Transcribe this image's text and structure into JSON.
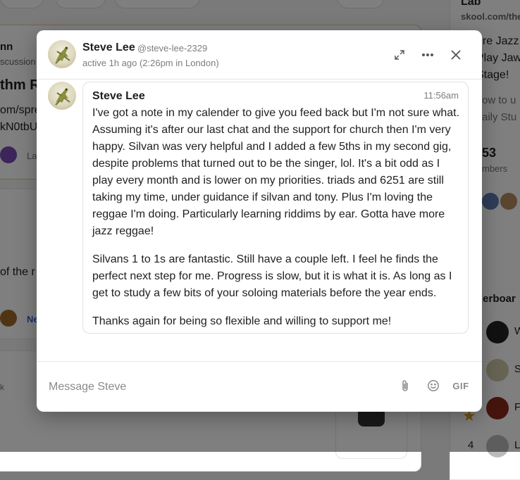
{
  "background": {
    "left_snippets": [
      "nn",
      "scussion",
      "thm R",
      "om/spre",
      "kN0tbU",
      "La",
      "of the r",
      "Ne",
      "k"
    ],
    "right_snippets": [
      "Lab",
      "skool.com/the",
      "ere Jazz",
      "Play Jaw",
      "Stage!",
      "ow to u",
      "aily Stu",
      "53",
      "mbers",
      "derboar",
      "W",
      "S",
      "F",
      "L",
      "4"
    ]
  },
  "modal": {
    "header": {
      "name": "Steve Lee",
      "handle": "@steve-lee-2329",
      "status": "active 1h ago (2:26pm in London)",
      "icons": {
        "expand": "expand-icon",
        "more": "more-options-icon",
        "close": "close-icon"
      }
    },
    "message": {
      "sender": "Steve Lee",
      "time": "11:56am",
      "paragraphs": [
        "I've got a note in my calender to give you feed back but I'm not sure what. Assuming it's after our last chat and the support for church then I'm very happy. Silvan was very helpful and I added a few 5ths in my second gig, despite problems that turned out to be the singer, lol. It's a bit odd as I play every month and is lower on my priorities. triads and 6251 are still taking my time, under guidance if silvan and tony. Plus I'm loving the reggae I'm doing. Particularly learning riddims by ear. Gotta have more jazz reggae!",
        "Silvans 1 to 1s are fantastic. Still have a couple left. I feel he finds the perfect next step for me. Progress is slow, but it is what it is. As long as I get to study a few bits of your soloing materials before the year ends.",
        "Thanks again for being so flexible and willing to support me!"
      ]
    },
    "composer": {
      "placeholder": "Message Steve",
      "value": "",
      "gif_label": "GIF",
      "icons": {
        "attach": "paperclip-icon",
        "emoji": "emoji-icon"
      }
    }
  },
  "colors": {
    "text": "#202124",
    "muted": "#7d7d7d",
    "link": "#3b5bdb",
    "overlay": "rgba(0,0,0,0.5)"
  }
}
